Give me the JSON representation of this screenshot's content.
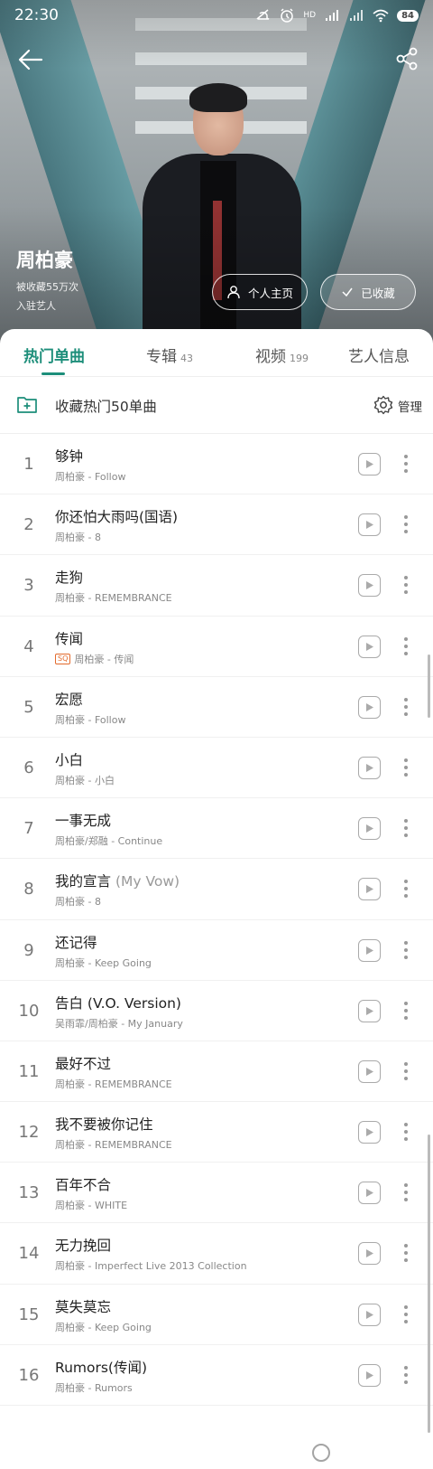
{
  "status_bar": {
    "time": "22:30",
    "network": "HD",
    "battery": "84",
    "icons": [
      "mute-icon",
      "alarm-icon",
      "signal-icon",
      "signal-icon",
      "wifi-icon"
    ]
  },
  "header": {
    "artist_name": "周柏豪",
    "favorites_text": "被收藏55万次",
    "settled_text": "入驻艺人",
    "homepage_button": "个人主页",
    "favorited_button": "已收藏"
  },
  "tabs": [
    {
      "label": "热门单曲",
      "count": ""
    },
    {
      "label": "专辑",
      "count": "43"
    },
    {
      "label": "视频",
      "count": "199"
    },
    {
      "label": "艺人信息",
      "count": ""
    }
  ],
  "collect_bar": {
    "label": "收藏热门50单曲",
    "manage_label": "管理"
  },
  "songs": [
    {
      "num": "1",
      "title": "够钟",
      "title_suffix": "",
      "sub": "周柏豪 - Follow",
      "sq": false
    },
    {
      "num": "2",
      "title": "你还怕大雨吗(国语)",
      "title_suffix": "",
      "sub": "周柏豪 - 8",
      "sq": false
    },
    {
      "num": "3",
      "title": "走狗",
      "title_suffix": "",
      "sub": "周柏豪 - REMEMBRANCE",
      "sq": false
    },
    {
      "num": "4",
      "title": "传闻",
      "title_suffix": "",
      "sub": "周柏豪 - 传闻",
      "sq": true,
      "sq_label": "SQ"
    },
    {
      "num": "5",
      "title": "宏愿",
      "title_suffix": "",
      "sub": "周柏豪 - Follow",
      "sq": false
    },
    {
      "num": "6",
      "title": "小白",
      "title_suffix": "",
      "sub": "周柏豪 - 小白",
      "sq": false
    },
    {
      "num": "7",
      "title": "一事无成",
      "title_suffix": "",
      "sub": "周柏豪/郑融 - Continue",
      "sq": false
    },
    {
      "num": "8",
      "title": "我的宣言",
      "title_suffix": " (My Vow)",
      "sub": "周柏豪 - 8",
      "sq": false
    },
    {
      "num": "9",
      "title": "还记得",
      "title_suffix": "",
      "sub": "周柏豪 - Keep Going",
      "sq": false
    },
    {
      "num": "10",
      "title": "告白 (V.O. Version)",
      "title_suffix": "",
      "sub": "吴雨霏/周柏豪 - My January",
      "sq": false
    },
    {
      "num": "11",
      "title": "最好不过",
      "title_suffix": "",
      "sub": "周柏豪 - REMEMBRANCE",
      "sq": false
    },
    {
      "num": "12",
      "title": "我不要被你记住",
      "title_suffix": "",
      "sub": "周柏豪 - REMEMBRANCE",
      "sq": false
    },
    {
      "num": "13",
      "title": "百年不合",
      "title_suffix": "",
      "sub": "周柏豪 - WHITE",
      "sq": false
    },
    {
      "num": "14",
      "title": "无力挽回",
      "title_suffix": "",
      "sub": "周柏豪 - Imperfect Live 2013 Collection",
      "sq": false
    },
    {
      "num": "15",
      "title": "莫失莫忘",
      "title_suffix": "",
      "sub": "周柏豪 - Keep Going",
      "sq": false
    },
    {
      "num": "16",
      "title": "Rumors(传闻)",
      "title_suffix": "",
      "sub": "周柏豪 - Rumors",
      "sq": false
    }
  ],
  "colors": {
    "accent": "#1d8e7a",
    "sq_badge": "#e36a2c"
  }
}
